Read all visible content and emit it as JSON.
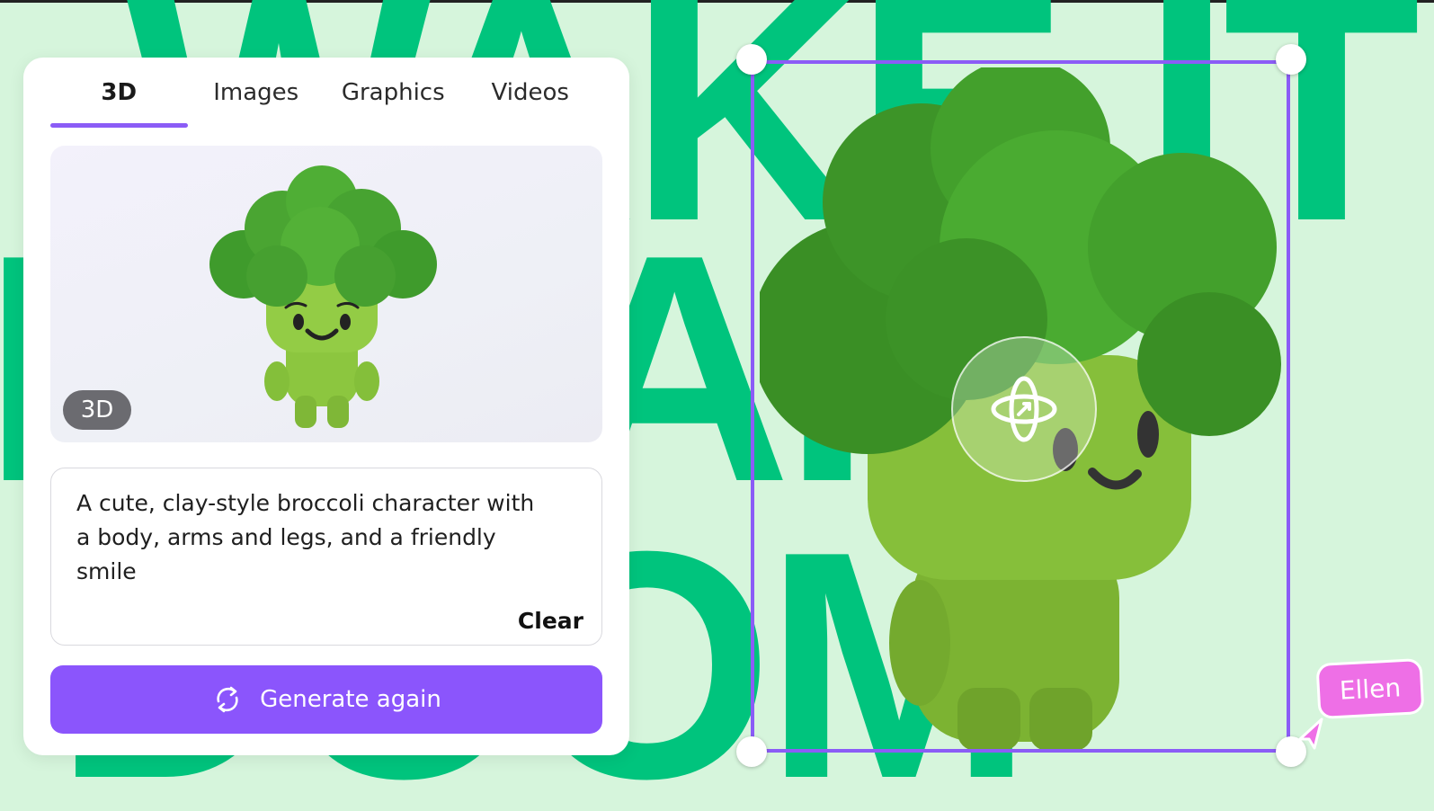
{
  "tabs": [
    {
      "label": "3D",
      "active": true
    },
    {
      "label": "Images",
      "active": false
    },
    {
      "label": "Graphics",
      "active": false
    },
    {
      "label": "Videos",
      "active": false
    }
  ],
  "preview": {
    "badge": "3D"
  },
  "prompt": {
    "text": "A cute, clay-style broccoli character with a body, arms and legs, and a friendly smile",
    "clear_label": "Clear"
  },
  "generate": {
    "label": "Generate again"
  },
  "canvas": {
    "collaborator_name": "Ellen"
  },
  "colors": {
    "accent": "#8b5cf6",
    "button": "#8b55fc",
    "background": "#d6f5dc",
    "letters": "#00c47d",
    "collaborator": "#ee6fe6"
  },
  "icons": {
    "generate": "refresh-icon",
    "rotate": "rotate-3d-icon",
    "cursor": "cursor-arrow-icon"
  }
}
